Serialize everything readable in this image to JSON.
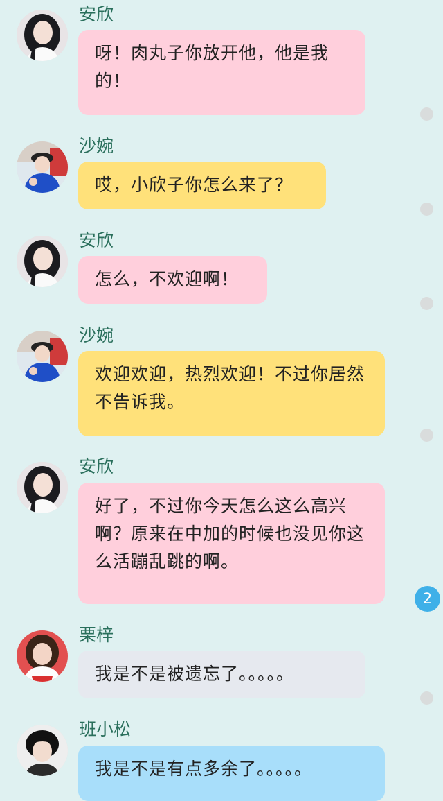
{
  "colors": {
    "background": "#dff1f1",
    "name_text": "#2a6f5c",
    "bubble_pink": "#ffcfdc",
    "bubble_yellow": "#ffe17a",
    "bubble_gray": "#e6e9ef",
    "bubble_blue": "#a8defa",
    "badge": "#3fb0e8"
  },
  "messages": [
    {
      "sender": "安欣",
      "text": "呀！肉丸子你放开他，他是我的！",
      "avatar": "anxin-avatar",
      "bubble_color": "pink"
    },
    {
      "sender": "沙婉",
      "text": "哎，小欣子你怎么来了？",
      "avatar": "shawan-avatar",
      "bubble_color": "yellow"
    },
    {
      "sender": "安欣",
      "text": "怎么，不欢迎啊！",
      "avatar": "anxin-avatar",
      "bubble_color": "pink"
    },
    {
      "sender": "沙婉",
      "text": "欢迎欢迎，热烈欢迎！不过你居然不告诉我。",
      "avatar": "shawan-avatar",
      "bubble_color": "yellow"
    },
    {
      "sender": "安欣",
      "text": "好了，不过你今天怎么这么高兴啊？原来在中加的时候也没见你这么活蹦乱跳的啊。",
      "avatar": "anxin-avatar",
      "bubble_color": "pink"
    },
    {
      "sender": "栗梓",
      "text": "我是不是被遗忘了。。。。。",
      "avatar": "lizi-avatar",
      "bubble_color": "gray"
    },
    {
      "sender": "班小松",
      "text": "我是不是有点多余了。。。。。",
      "avatar": "banxiaosong-avatar",
      "bubble_color": "blue"
    }
  ],
  "comment_badge_count": "2"
}
